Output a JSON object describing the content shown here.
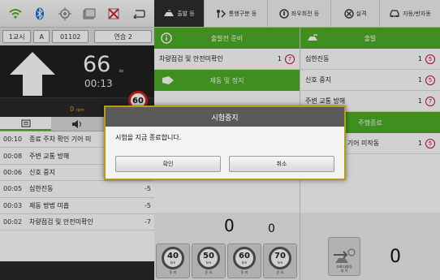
{
  "status_bar": {
    "icons": [
      "wifi-icon",
      "bluetooth-icon",
      "gps-icon",
      "window-icon",
      "no-signal-icon",
      "back-icon"
    ]
  },
  "info": {
    "period": "1교시",
    "course": "A",
    "code": "01102",
    "practice": "연습 2"
  },
  "dash": {
    "speed": "66",
    "speed_unit": "㎞",
    "elapsed": "00:13",
    "rpm": "0",
    "rpm_unit": "rpm",
    "limit": "60"
  },
  "penalties": [
    {
      "time": "00:10",
      "text": "종료 주차 확인 기어 미",
      "score": ""
    },
    {
      "time": "00:08",
      "text": "주변 교통 방해",
      "score": ""
    },
    {
      "time": "00:06",
      "text": "신호 중지",
      "score": ""
    },
    {
      "time": "00:05",
      "text": "심한진동",
      "score": "-5"
    },
    {
      "time": "00:03",
      "text": "제동 방법 미흡",
      "score": "-5"
    },
    {
      "time": "00:02",
      "text": "차량점검 및 안전미확인",
      "score": "-7"
    }
  ],
  "top_tabs": [
    {
      "label": "출발 등",
      "icon": "car-start-icon",
      "active": true
    },
    {
      "label": "통행구분 등",
      "icon": "lane-icon",
      "active": false
    },
    {
      "label": "좌우회전 등",
      "icon": "turn-icon",
      "active": false
    },
    {
      "label": "실격",
      "icon": "disqualify-icon",
      "active": false
    },
    {
      "label": "자동/반자동",
      "icon": "auto-car-icon",
      "active": false
    }
  ],
  "mid": {
    "sec1": "출발전 준비",
    "row1": {
      "text": "차량점검 및 안전미확인",
      "count": "1",
      "penalty": "7"
    },
    "sec2": "제동 및 정지",
    "counter_a": "0",
    "counter_b": "0"
  },
  "right": {
    "sec1": "출발",
    "rows": [
      {
        "text": "심한진동",
        "count": "1",
        "penalty": "5"
      },
      {
        "text": "신호 중지",
        "count": "1",
        "penalty": "5"
      },
      {
        "text": "주변 교통 방해",
        "count": "1",
        "penalty": "7"
      }
    ],
    "sec2": "주행종료",
    "row_end": {
      "text": "종료 주차 확인 기어 미작동",
      "count": "1",
      "penalty": "5"
    },
    "park_label": "조회/내용등\n대 기",
    "counter_c": "0"
  },
  "speed_tests": [
    {
      "value": "40",
      "unit": "km",
      "label": "준 비"
    },
    {
      "value": "50",
      "unit": "km",
      "label": "준 비"
    },
    {
      "value": "60",
      "unit": "km",
      "label": "준 비"
    },
    {
      "value": "70",
      "unit": "km",
      "label": "준 비"
    }
  ],
  "modal": {
    "title": "시험중지",
    "message": "시험을 지금 종료합니다.",
    "confirm": "확인",
    "cancel": "취소"
  },
  "colors": {
    "accent_green": "#4caf26",
    "modal_border": "#b59b19",
    "penalty_red": "#c0123b",
    "dark_panel": "#202020"
  }
}
